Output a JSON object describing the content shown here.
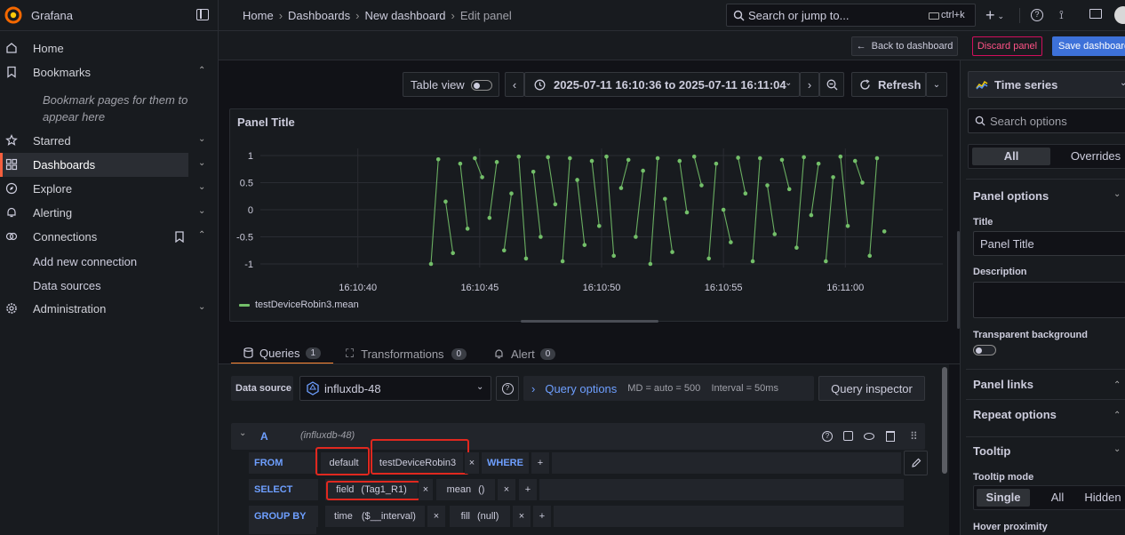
{
  "app": {
    "name": "Grafana"
  },
  "breadcrumb": {
    "home": "Home",
    "dashboards": "Dashboards",
    "new_dashboard": "New dashboard",
    "edit_panel": "Edit panel",
    "sep": "›"
  },
  "search": {
    "placeholder": "Search or jump to...",
    "shortcut": "ctrl+k"
  },
  "topbar_icons": [
    "plus-icon",
    "help-icon",
    "rss-icon",
    "kiosk-icon",
    "avatar"
  ],
  "sidebar": {
    "items": [
      {
        "label": "Home",
        "icon": "home-icon"
      },
      {
        "label": "Bookmarks",
        "icon": "bookmark-icon"
      },
      {
        "label": "Starred",
        "icon": "star-icon"
      },
      {
        "label": "Dashboards",
        "icon": "apps-icon",
        "active": true
      },
      {
        "label": "Explore",
        "icon": "compass-icon"
      },
      {
        "label": "Alerting",
        "icon": "bell-icon"
      },
      {
        "label": "Connections",
        "icon": "connections-icon"
      },
      {
        "label": "Administration",
        "icon": "cog-icon"
      }
    ],
    "bookmarks_hint": [
      "Bookmark pages for them to",
      "appear here"
    ],
    "connections_sub": [
      "Add new connection",
      "Data sources"
    ]
  },
  "toolbar": {
    "back": "Back to dashboard",
    "discard": "Discard panel",
    "save": "Save dashboard"
  },
  "panel_toolbar": {
    "table_view": "Table view",
    "time_range": "2025-07-11 16:10:36 to 2025-07-11 16:11:04",
    "refresh": "Refresh"
  },
  "panel": {
    "title": "Panel Title"
  },
  "chart_data": {
    "type": "scatter",
    "title": "Panel Title",
    "xlabel": "",
    "ylabel": "",
    "x_ticks": [
      "16:10:40",
      "16:10:45",
      "16:10:50",
      "16:10:55",
      "16:11:00"
    ],
    "y_ticks": [
      "1",
      "0.5",
      "0",
      "-0.5",
      "-1"
    ],
    "xlim": [
      "2025-07-11 16:10:36",
      "2025-07-11 16:11:04"
    ],
    "ylim": [
      -1,
      1
    ],
    "grid": true,
    "legend": "bottom-left",
    "series": [
      {
        "name": "testDeviceRobin3.mean",
        "color": "#73bf69",
        "x": [
          "16:10:43.0",
          "16:10:43.3",
          "16:10:43.6",
          "16:10:43.9",
          "16:10:44.2",
          "16:10:44.5",
          "16:10:44.8",
          "16:10:45.1",
          "16:10:45.4",
          "16:10:45.7",
          "16:10:46.0",
          "16:10:46.3",
          "16:10:46.6",
          "16:10:46.9",
          "16:10:47.2",
          "16:10:47.5",
          "16:10:47.8",
          "16:10:48.1",
          "16:10:48.4",
          "16:10:48.7",
          "16:10:49.0",
          "16:10:49.3",
          "16:10:49.6",
          "16:10:49.9",
          "16:10:50.2",
          "16:10:50.5",
          "16:10:50.8",
          "16:10:51.1",
          "16:10:51.4",
          "16:10:51.7",
          "16:10:52.0",
          "16:10:52.3",
          "16:10:52.6",
          "16:10:52.9",
          "16:10:53.2",
          "16:10:53.5",
          "16:10:53.8",
          "16:10:54.1",
          "16:10:54.4",
          "16:10:54.7",
          "16:10:55.0",
          "16:10:55.3",
          "16:10:55.6",
          "16:10:55.9",
          "16:10:56.2",
          "16:10:56.5",
          "16:10:56.8",
          "16:10:57.1",
          "16:10:57.4",
          "16:10:57.7",
          "16:10:58.0",
          "16:10:58.3",
          "16:10:58.6",
          "16:10:58.9",
          "16:10:59.2",
          "16:10:59.5",
          "16:10:59.8",
          "16:11:00.1",
          "16:11:00.4",
          "16:11:00.7",
          "16:11:01.0",
          "16:11:01.3",
          "16:11:01.6"
        ],
        "y": [
          -1.0,
          0.93,
          0.15,
          -0.8,
          0.85,
          -0.35,
          0.95,
          0.6,
          -0.15,
          0.88,
          -0.75,
          0.3,
          0.98,
          -0.9,
          0.7,
          -0.5,
          0.97,
          0.1,
          -0.95,
          0.95,
          0.55,
          -0.65,
          0.9,
          -0.3,
          0.98,
          -0.85,
          0.4,
          0.92,
          -0.5,
          0.72,
          -1.0,
          0.95,
          0.2,
          -0.78,
          0.9,
          -0.05,
          0.98,
          0.45,
          -0.9,
          0.85,
          0.0,
          -0.6,
          0.96,
          0.3,
          -0.95,
          0.95,
          0.45,
          -0.45,
          0.92,
          0.38,
          -0.7,
          0.97,
          -0.1,
          0.85,
          -0.95,
          0.6,
          0.98,
          -0.3,
          0.9,
          0.5,
          -0.85,
          0.95,
          -0.4
        ]
      }
    ]
  },
  "query_tabs": [
    {
      "label": "Queries",
      "count": "1",
      "icon": "database-icon",
      "active": true
    },
    {
      "label": "Transformations",
      "count": "0",
      "icon": "transformations-icon"
    },
    {
      "label": "Alert",
      "count": "0",
      "icon": "bell-icon"
    }
  ],
  "datasource": {
    "label": "Data source",
    "name": "influxdb-48",
    "query_options": "Query options",
    "query_meta": "MD = auto = 500    Interval = 50ms",
    "inspector": "Query inspector"
  },
  "query": {
    "ref": "A",
    "ds_hint": "(influxdb-48)",
    "from_label": "FROM",
    "policy": "default",
    "measurement": "testDeviceRobin3",
    "where_label": "WHERE",
    "select_label": "SELECT",
    "field": "field",
    "field_arg": "(Tag1_R1)",
    "mean": "mean",
    "mean_arg": "()",
    "group_by_label": "GROUP BY",
    "time": "time",
    "time_arg": "($__interval)",
    "fill": "fill",
    "fill_arg": "(null)",
    "plus": "+",
    "x": "×"
  },
  "options": {
    "viz": "Time series",
    "search_placeholder": "Search options",
    "tab_all": "All",
    "tab_overrides": "Overrides",
    "panel_options": "Panel options",
    "title_label": "Title",
    "title_value": "Panel Title",
    "description_label": "Description",
    "transparent_label": "Transparent background",
    "panel_links": "Panel links",
    "repeat_options": "Repeat options",
    "tooltip": "Tooltip",
    "tooltip_mode": "Tooltip mode",
    "mode_single": "Single",
    "mode_all": "All",
    "mode_hidden": "Hidden",
    "hover_proximity": "Hover proximity"
  }
}
